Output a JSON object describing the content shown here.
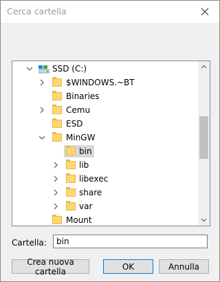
{
  "window": {
    "title": "Cerca cartella",
    "close_icon": "close-icon"
  },
  "tree": {
    "items": [
      {
        "label": "SSD (C:)",
        "icon": "drive-icon",
        "expander": "chevron-down-icon",
        "level": 0,
        "expanded": true
      },
      {
        "label": "$WINDOWS.~BT",
        "icon": "folder-icon",
        "expander": "chevron-right-icon",
        "level": 1
      },
      {
        "label": "Binaries",
        "icon": "folder-icon",
        "expander": "",
        "level": 1
      },
      {
        "label": "Cemu",
        "icon": "folder-icon",
        "expander": "chevron-right-icon",
        "level": 1
      },
      {
        "label": "ESD",
        "icon": "folder-icon",
        "expander": "",
        "level": 1
      },
      {
        "label": "MinGW",
        "icon": "folder-icon",
        "expander": "chevron-down-icon",
        "level": 1,
        "expanded": true
      },
      {
        "label": "bin",
        "icon": "folder-icon",
        "expander": "",
        "level": 2,
        "selected": true
      },
      {
        "label": "lib",
        "icon": "folder-icon",
        "expander": "chevron-right-icon",
        "level": 2
      },
      {
        "label": "libexec",
        "icon": "folder-icon",
        "expander": "chevron-right-icon",
        "level": 2
      },
      {
        "label": "share",
        "icon": "folder-icon",
        "expander": "chevron-right-icon",
        "level": 2
      },
      {
        "label": "var",
        "icon": "folder-icon",
        "expander": "chevron-right-icon",
        "level": 2
      },
      {
        "label": "Mount",
        "icon": "folder-icon",
        "expander": "",
        "level": 1
      }
    ]
  },
  "folder_field": {
    "label": "Cartella:",
    "value": "bin"
  },
  "buttons": {
    "new_folder": "Crea nuova cartella",
    "ok": "OK",
    "cancel": "Annulla"
  },
  "colors": {
    "folder": "#ffd86b",
    "selection": "#d9d9d9",
    "default_button_border": "#0078d7"
  }
}
